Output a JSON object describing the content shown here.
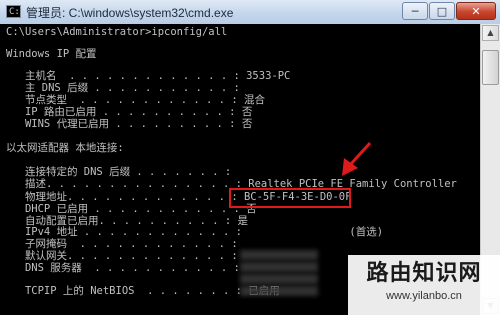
{
  "window": {
    "title": "管理员: C:\\windows\\system32\\cmd.exe",
    "icon": "cmd-icon",
    "minimize": "─",
    "maximize": "□",
    "close": "✕"
  },
  "console": {
    "lines": [
      "C:\\Users\\Administrator>ipconfig/all",
      "",
      "Windows IP 配置",
      "",
      "   主机名  . . . . . . . . . . . . . : 3533-PC",
      "   主 DNS 后缀 . . . . . . . . . . . :",
      "   节点类型  . . . . . . . . . . . . : 混合",
      "   IP 路由已启用 . . . . . . . . . . : 否",
      "   WINS 代理已启用 . . . . . . . . . : 否",
      "",
      "以太网适配器 本地连接:",
      "",
      "   连接特定的 DNS 后缀 . . . . . . . :",
      "   描述. . . . . . . . . . . . . . . : Realtek PCIe FE Family Controller",
      "   物理地址. . . . . . . . . . . . . : BC-5F-F4-3E-D0-0F",
      "   DHCP 已启用 . . . . . . . . . . . : 否",
      "   自动配置已启用. . . . . . . . . . : 是",
      "   IPv4 地址 . . . . . . . . . . . . :                 (首选)",
      "   子网掩码  . . . . . . . . . . . . :",
      "   默认网关. . . . . . . . . . . . . :",
      "   DNS 服务器  . . . . . . . . . . . :",
      "",
      "   TCPIP 上的 NetBIOS  . . . . . . . : 已启用"
    ]
  },
  "watermark": {
    "title": "路由知识网",
    "url": "www.yilanbo.cn"
  },
  "annotation": {
    "color": "#e01a1a"
  }
}
